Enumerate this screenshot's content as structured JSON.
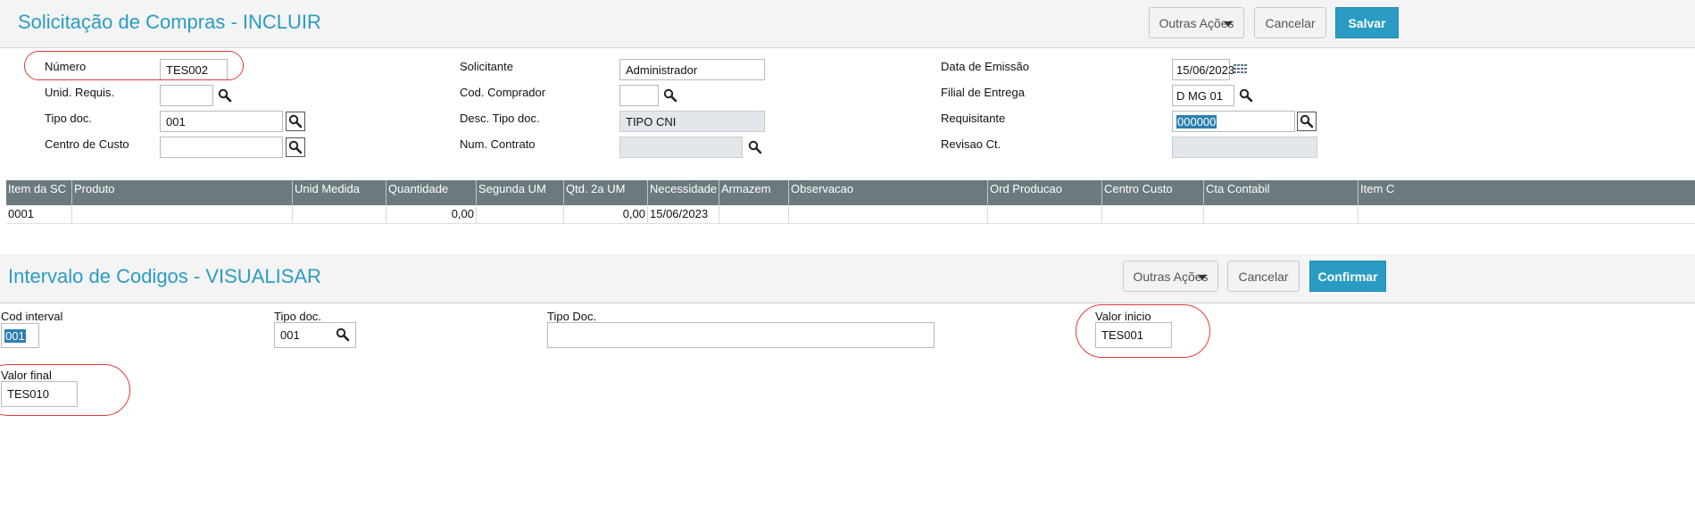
{
  "form1": {
    "title": "Solicitação de Compras - INCLUIR",
    "actions": {
      "more_label": "Outras Ações",
      "cancel_label": "Cancelar",
      "save_label": "Salvar"
    },
    "fields": {
      "numero": {
        "label": "Número",
        "value": "TES002"
      },
      "unid_requis": {
        "label": "Unid. Requis.",
        "value": ""
      },
      "tipo_doc": {
        "label": "Tipo doc.",
        "value": "001"
      },
      "centro_custo": {
        "label": "Centro de Custo",
        "value": ""
      },
      "solicitante": {
        "label": "Solicitante",
        "value": "Administrador"
      },
      "cod_comprador": {
        "label": "Cod. Comprador",
        "value": ""
      },
      "desc_tipo_doc": {
        "label": "Desc. Tipo doc.",
        "value": "TIPO CNI"
      },
      "num_contrato": {
        "label": "Num. Contrato",
        "value": ""
      },
      "data_emissao": {
        "label": "Data de Emissão",
        "value": "15/06/2023"
      },
      "filial_entrega": {
        "label": "Filial de Entrega",
        "value": "D MG 01"
      },
      "requisitante": {
        "label": "Requisitante",
        "value": "000000"
      },
      "revisao_ct": {
        "label": "Revisao Ct.",
        "value": ""
      }
    },
    "grid": {
      "columns": [
        "Item da SC",
        "Produto",
        "Unid Medida",
        "Quantidade",
        "Segunda UM",
        "Qtd. 2a UM",
        "Necessidade",
        "Armazem",
        "Observacao",
        "Ord Producao",
        "Centro Custo",
        "Cta Contabil",
        "Item Ct"
      ],
      "rows": [
        [
          "0001",
          "",
          "",
          "0,00",
          "",
          "0,00",
          "15/06/2023",
          "",
          "",
          "",
          "",
          "",
          ""
        ]
      ]
    }
  },
  "form2": {
    "title": "Intervalo de Codigos - VISUALISAR",
    "actions": {
      "more_label": "Outras Ações",
      "cancel_label": "Cancelar",
      "confirm_label": "Confirmar"
    },
    "fields": {
      "cod_interval": {
        "label": "Cod interval",
        "value": "001"
      },
      "tipo_doc": {
        "label": "Tipo doc.",
        "value": "001"
      },
      "tipo_doc_desc": {
        "label": "Tipo Doc.",
        "value": ""
      },
      "valor_inicio": {
        "label": "Valor inicio",
        "value": "TES001"
      },
      "valor_final": {
        "label": "Valor final",
        "value": "TES010"
      }
    }
  },
  "icons": {
    "lookup": "magnifier-icon",
    "calendar": "calendar-icon",
    "dropdown": "caret-down-icon"
  },
  "colors": {
    "accent": "#2a9cc4",
    "grid_header": "#6b7a7e",
    "highlight_annotation": "#e03a3a"
  }
}
